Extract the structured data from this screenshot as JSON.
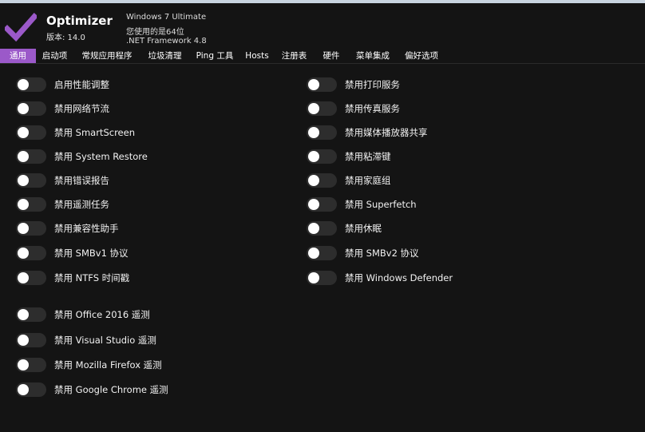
{
  "header": {
    "title": "Optimizer",
    "version": "版本: 14.0",
    "os": "Windows 7 Ultimate",
    "arch": "您使用的是64位",
    "framework": ".NET Framework 4.8"
  },
  "colors": {
    "accent": "#9b59c9",
    "background": "#141414",
    "toggle_off": "#2d2d2d"
  },
  "tabs": [
    {
      "label": "通用",
      "active": true
    },
    {
      "label": "启动项",
      "active": false
    },
    {
      "label": "常规应用程序",
      "active": false
    },
    {
      "label": "垃圾清理",
      "active": false
    },
    {
      "label": "Ping 工具",
      "active": false
    },
    {
      "label": "Hosts",
      "active": false
    },
    {
      "label": "注册表",
      "active": false
    },
    {
      "label": "硬件",
      "active": false
    },
    {
      "label": "菜单集成",
      "active": false
    },
    {
      "label": "偏好选项",
      "active": false
    }
  ],
  "left_options": [
    {
      "label": "启用性能调整",
      "on": false
    },
    {
      "label": "禁用网络节流",
      "on": false
    },
    {
      "label": "禁用 SmartScreen",
      "on": false
    },
    {
      "label": "禁用 System Restore",
      "on": false
    },
    {
      "label": "禁用错误报告",
      "on": false
    },
    {
      "label": "禁用遥测任务",
      "on": false
    },
    {
      "label": "禁用兼容性助手",
      "on": false
    },
    {
      "label": "禁用 SMBv1 协议",
      "on": false
    },
    {
      "label": "禁用 NTFS 时间戳",
      "on": false
    }
  ],
  "right_options": [
    {
      "label": "禁用打印服务",
      "on": false
    },
    {
      "label": "禁用传真服务",
      "on": false
    },
    {
      "label": "禁用媒体播放器共享",
      "on": false
    },
    {
      "label": "禁用粘滞键",
      "on": false
    },
    {
      "label": "禁用家庭组",
      "on": false
    },
    {
      "label": "禁用 Superfetch",
      "on": false
    },
    {
      "label": "禁用休眠",
      "on": false
    },
    {
      "label": "禁用 SMBv2 协议",
      "on": false
    },
    {
      "label": "禁用 Windows Defender",
      "on": false
    }
  ],
  "telemetry_options": [
    {
      "label": "禁用 Office 2016 遥测",
      "on": false
    },
    {
      "label": "禁用 Visual Studio 遥测",
      "on": false
    },
    {
      "label": "禁用 Mozilla Firefox 遥测",
      "on": false
    },
    {
      "label": "禁用 Google Chrome 遥测",
      "on": false
    }
  ]
}
